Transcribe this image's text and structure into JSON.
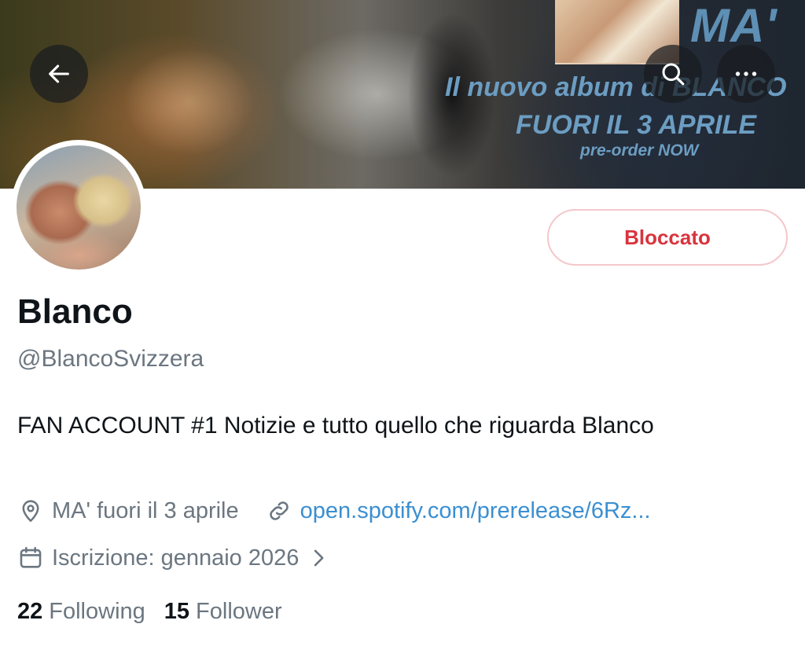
{
  "banner": {
    "album_title": "MA'",
    "promo_line_1": "Il nuovo album di BLANCO",
    "promo_line_2": "FUORI IL 3 APRILE",
    "promo_line_3": "pre-order NOW",
    "text_color": "#6c9dc2"
  },
  "nav": {
    "back_icon": "arrow-left-icon",
    "search_icon": "search-icon",
    "more_icon": "more-horizontal-icon"
  },
  "profile": {
    "display_name": "Blanco",
    "handle": "@BlancoSvizzera",
    "bio": "FAN ACCOUNT #1 Notizie e tutto quello che riguarda Blanco",
    "location": "MA' fuori il 3 aprile",
    "link": "open.spotify.com/prerelease/6Rz...",
    "joined": "Iscrizione: gennaio 2026"
  },
  "action": {
    "blocked_label": "Bloccato",
    "blocked_color": "#d9343e"
  },
  "stats": {
    "following_count": "22",
    "following_label": "Following",
    "followers_count": "15",
    "followers_label": "Follower"
  },
  "colors": {
    "link": "#3b8fd1",
    "secondary_text": "#6b7680",
    "primary_text": "#0f1419"
  }
}
